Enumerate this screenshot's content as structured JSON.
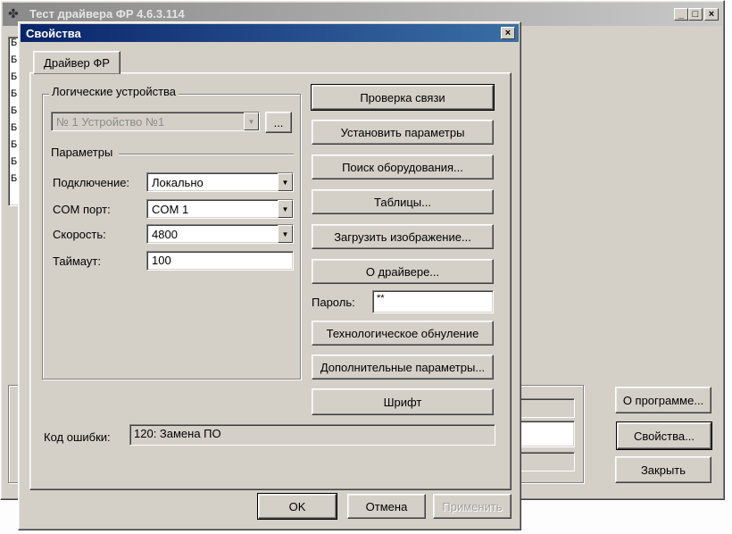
{
  "main_window": {
    "title": "Тест драйвера ФР 4.6.3.114",
    "list_markers": [
      "Б",
      "Б",
      "Б",
      "Б",
      "Б",
      "Б",
      "Б",
      "Б",
      "Б",
      "Б"
    ],
    "buttons": {
      "about_program": "О программе...",
      "properties": "Свойства...",
      "close": "Закрыть"
    }
  },
  "dialog": {
    "title": "Свойства",
    "tab": "Драйвер ФР",
    "logical_devices": {
      "group_label": "Логические устройства",
      "device_value": "№ 1 Устройство №1",
      "browse_label": "..."
    },
    "params": {
      "group_label": "Параметры",
      "connection_label": "Подключение:",
      "connection_value": "Локально",
      "com_label": "COM порт:",
      "com_value": "COM 1",
      "speed_label": "Скорость:",
      "speed_value": "4800",
      "timeout_label": "Таймаут:",
      "timeout_value": "100"
    },
    "actions": {
      "check_connection": "Проверка связи",
      "set_params": "Установить параметры",
      "search_equipment": "Поиск оборудования...",
      "tables": "Таблицы...",
      "load_image": "Загрузить изображение...",
      "about_driver": "О драйвере...",
      "password_label": "Пароль:",
      "password_value": "**",
      "tech_reset": "Технологическое обнуление",
      "extra_params": "Дополнительные параметры...",
      "font": "Шрифт"
    },
    "error": {
      "label": "Код ошибки:",
      "value": "120: Замена ПО"
    },
    "footer": {
      "ok": "OK",
      "cancel": "Отмена",
      "apply": "Применить"
    }
  }
}
